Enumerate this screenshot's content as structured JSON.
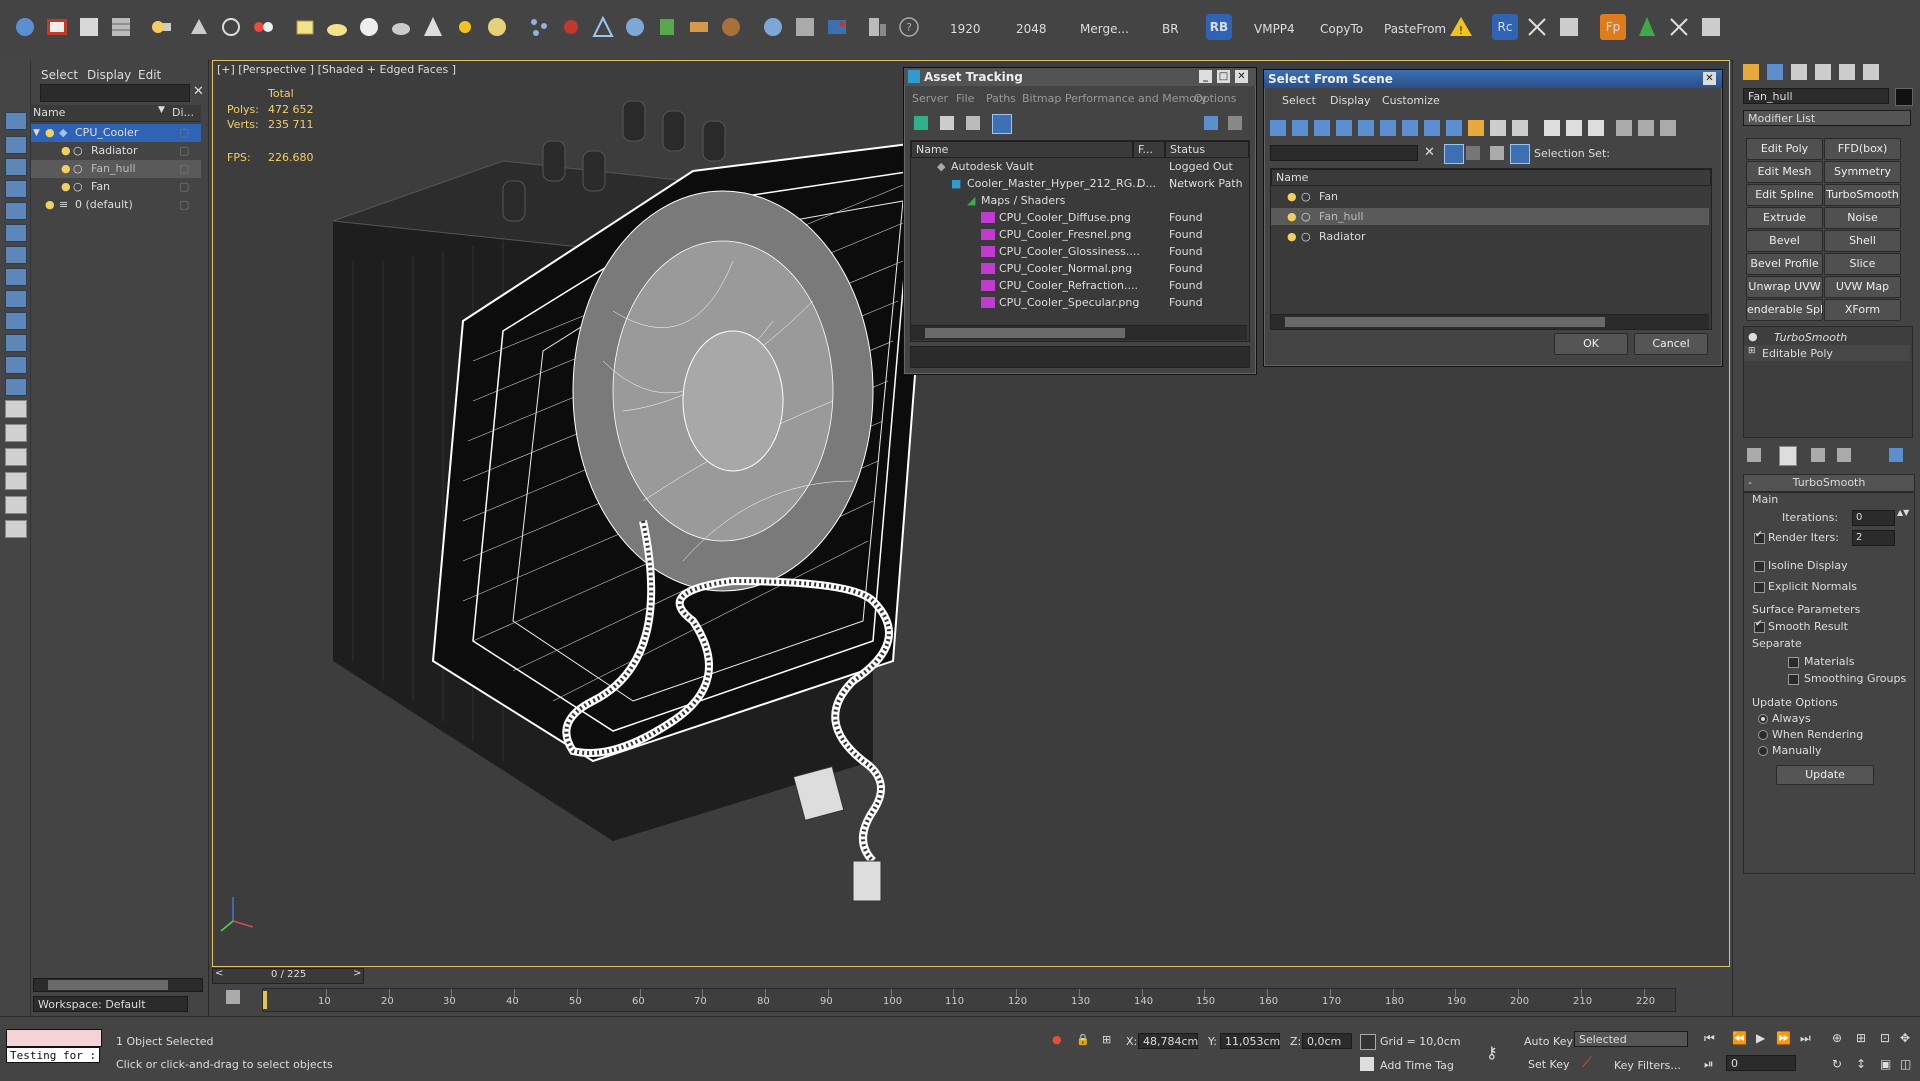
{
  "toolbar": {
    "render_width": "1920",
    "render_height": "2048",
    "merge_label": "Merge...",
    "br_label": "BR",
    "rb_label": "RB",
    "vmpp4_label": "VMPP4",
    "copyto_label": "CopyTo",
    "pastefrom_label": "PasteFrom",
    "rc_label": "Rc",
    "fp_label": "Fp"
  },
  "scene_explorer": {
    "menu": [
      "Select",
      "Display",
      "Edit"
    ],
    "col_name": "Name",
    "col_display": "Di...",
    "items": [
      {
        "label": "CPU_Cooler"
      },
      {
        "label": "Radiator"
      },
      {
        "label": "Fan_hull"
      },
      {
        "label": "Fan"
      },
      {
        "label": "0 (default)"
      }
    ],
    "workspace": "Workspace: Default"
  },
  "viewport": {
    "label": "[+] [Perspective ] [Shaded + Edged Faces ]",
    "stats_total": "Total",
    "polys_label": "Polys:",
    "polys_value": "472 652",
    "verts_label": "Verts:",
    "verts_value": "235 711",
    "fps_label": "FPS:",
    "fps_value": "226.680"
  },
  "asset_tracking": {
    "title": "Asset Tracking",
    "menu": [
      "Server",
      "File",
      "Paths",
      "Bitmap Performance and Memory",
      "Options"
    ],
    "col_name": "Name",
    "col_f": "F...",
    "col_status": "Status",
    "rows": [
      {
        "name": "Autodesk Vault",
        "f": "",
        "status": "Logged Out (..."
      },
      {
        "name": "Cooler_Master_Hyper_212_RG...",
        "f": "D...",
        "status": "Network Path"
      },
      {
        "name": "Maps / Shaders",
        "f": "",
        "status": ""
      },
      {
        "name": "CPU_Cooler_Diffuse.png",
        "f": "",
        "status": "Found"
      },
      {
        "name": "CPU_Cooler_Fresnel.png",
        "f": "",
        "status": "Found"
      },
      {
        "name": "CPU_Cooler_Glossiness....",
        "f": "",
        "status": "Found"
      },
      {
        "name": "CPU_Cooler_Normal.png",
        "f": "",
        "status": "Found"
      },
      {
        "name": "CPU_Cooler_Refraction....",
        "f": "",
        "status": "Found"
      },
      {
        "name": "CPU_Cooler_Specular.png",
        "f": "",
        "status": "Found"
      }
    ]
  },
  "select_from_scene": {
    "title": "Select From Scene",
    "menu": [
      "Select",
      "Display",
      "Customize"
    ],
    "selection_set_label": "Selection Set:",
    "col_name": "Name",
    "items": [
      "Fan",
      "Fan_hull",
      "Radiator"
    ],
    "ok_label": "OK",
    "cancel_label": "Cancel"
  },
  "command_panel": {
    "object_name": "Fan_hull",
    "modifier_list": "Modifier List",
    "modifier_buttons": [
      "Edit Poly",
      "FFD(box)",
      "Edit Mesh",
      "Symmetry",
      "Edit Spline",
      "TurboSmooth",
      "Extrude",
      "Noise",
      "Bevel",
      "Shell",
      "Bevel Profile",
      "Slice",
      "Unwrap UVW",
      "UVW Map",
      "enderable Splin",
      "XForm"
    ],
    "stack": [
      "TurboSmooth",
      "Editable Poly"
    ],
    "turbosmooth": {
      "title": "TurboSmooth",
      "main_label": "Main",
      "iterations_label": "Iterations:",
      "iterations_value": "0",
      "render_iters_label": "Render Iters:",
      "render_iters_value": "2",
      "isoline_label": "Isoline Display",
      "explicit_normals_label": "Explicit Normals",
      "surface_params_label": "Surface Parameters",
      "smooth_result_label": "Smooth Result",
      "separate_label": "Separate",
      "materials_label": "Materials",
      "smoothing_groups_label": "Smoothing Groups",
      "update_options_label": "Update Options",
      "always_label": "Always",
      "when_rendering_label": "When Rendering",
      "manually_label": "Manually",
      "update_button": "Update"
    }
  },
  "timeline": {
    "frame_counter": "0 / 225",
    "ticks": [
      "10",
      "20",
      "30",
      "40",
      "50",
      "60",
      "70",
      "80",
      "90",
      "100",
      "110",
      "120",
      "130",
      "140",
      "150",
      "160",
      "170",
      "180",
      "190",
      "200",
      "210",
      "220"
    ]
  },
  "status_bar": {
    "script_text": "Testing for :",
    "selected_text": "1 Object Selected",
    "prompt_text": "Click or click-and-drag to select objects",
    "x_label": "X:",
    "x_value": "48,784cm",
    "y_label": "Y:",
    "y_value": "11,053cm",
    "z_label": "Z:",
    "z_value": "0,0cm",
    "grid_text": "Grid = 10,0cm",
    "add_time_tag": "Add Time Tag",
    "auto_key": "Auto Key",
    "set_key": "Set Key",
    "selected_dropdown": "Selected",
    "key_filters": "Key Filters...",
    "frame_value": "0"
  }
}
